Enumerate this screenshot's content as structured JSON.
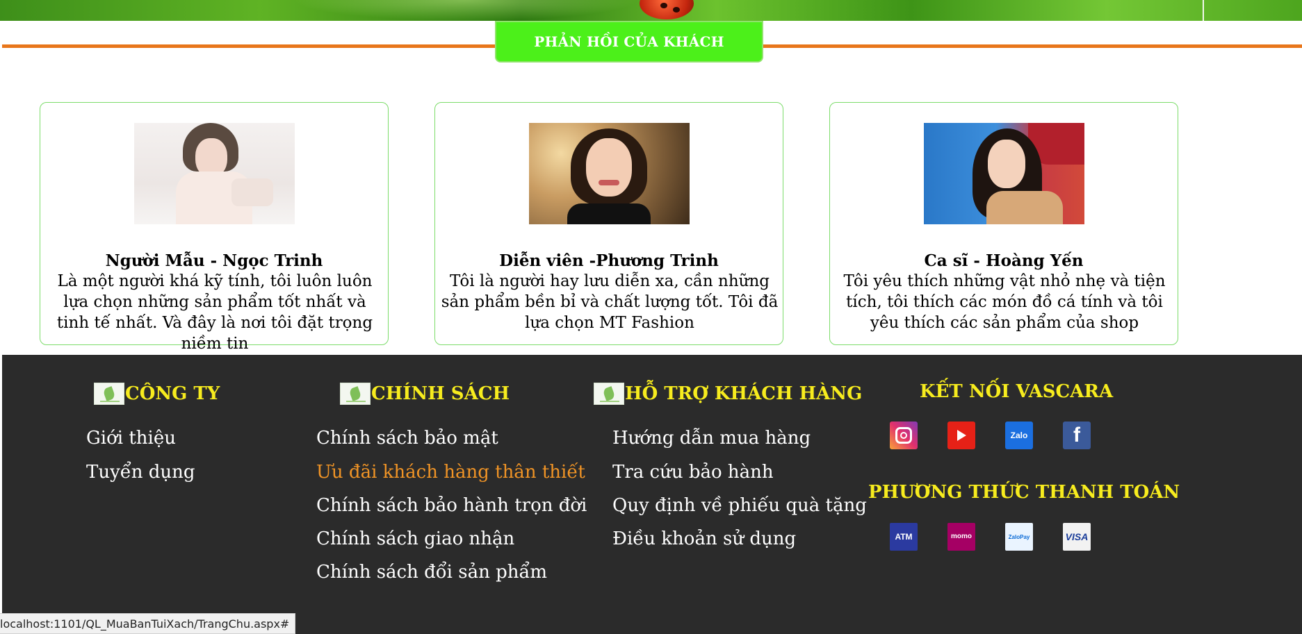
{
  "section_title": "PHẢN HỒI CỦA KHÁCH",
  "testimonials": [
    {
      "name": "Người Mẫu - Ngọc Trinh",
      "quote": "Là một người khá kỹ tính, tôi luôn luôn lựa chọn những sản phẩm tốt nhất và tinh tế nhất. Và đây là nơi tôi đặt trọng niềm tin"
    },
    {
      "name": "Diễn viên -Phương Trinh",
      "quote": "Tôi là người hay lưu diễn xa, cần những sản phẩm bền bỉ và chất lượng tốt. Tôi đã lựa chọn MT Fashion"
    },
    {
      "name": "Ca sĩ - Hoàng Yến",
      "quote": "Tôi yêu thích những vật nhỏ nhẹ và tiện tích, tôi thích các món đồ cá tính và tôi yêu thích các sản phẩm của shop"
    }
  ],
  "footer": {
    "company": {
      "heading": "CÔNG TY",
      "links": [
        "Giới thiệu",
        "Tuyển dụng"
      ]
    },
    "policy": {
      "heading": "CHÍNH SÁCH",
      "links": [
        "Chính sách bảo mật",
        "Ưu đãi khách hàng thân thiết",
        "Chính sách bảo hành trọn đời",
        "Chính sách giao nhận",
        "Chính sách đổi sản phẩm"
      ]
    },
    "support": {
      "heading": "HỖ TRỢ KHÁCH HÀNG",
      "links": [
        "Hướng dẫn mua hàng",
        "Tra cứu bảo hành",
        "Quy định về phiếu quà tặng",
        "Điều khoản sử dụng"
      ]
    },
    "connect": {
      "heading": "KẾT NỐI VASCARA",
      "icons": [
        "instagram-icon",
        "youtube-icon",
        "zalo-icon",
        "facebook-icon"
      ],
      "zalo_label": "Zalo",
      "facebook_label": "f"
    },
    "payment": {
      "heading": "PHƯƠNG THỨC THANH TOÁN",
      "methods": [
        "ATM",
        "momo",
        "ZaloPay",
        "VISA"
      ]
    }
  },
  "status_bar": "localhost:1101/QL_MuaBanTuiXach/TrangChu.aspx#",
  "colors": {
    "accent_green": "#4cf01a",
    "rule_orange": "#e8761a",
    "footer_bg": "#2b2b2b",
    "footer_heading": "#f7ec1e",
    "link_hover": "#f09426"
  }
}
